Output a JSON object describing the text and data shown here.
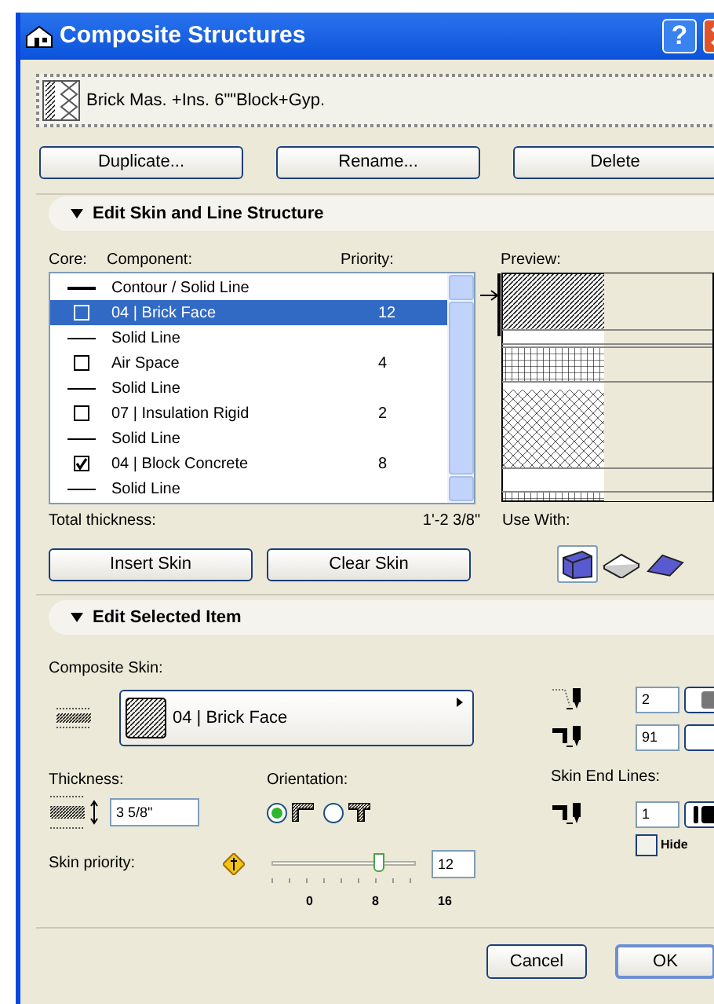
{
  "window": {
    "title": "Composite Structures",
    "help": "?"
  },
  "composite": {
    "name": "Brick Mas. +Ins. 6\"\"Block+Gyp."
  },
  "top_buttons": [
    "Duplicate...",
    "Rename...",
    "Delete"
  ],
  "skin_section": {
    "title": "Edit Skin and Line Structure",
    "expanded": true,
    "columns": [
      "Core:",
      "Component:",
      "Priority:"
    ],
    "rows": [
      {
        "kind": "line",
        "name": "Contour / Solid Line",
        "heavy": true
      },
      {
        "kind": "skin",
        "name": "04 | Brick Face",
        "core": false,
        "priority": "12",
        "selected": true
      },
      {
        "kind": "line",
        "name": "Solid Line",
        "heavy": false
      },
      {
        "kind": "skin",
        "name": "Air Space",
        "core": false,
        "priority": "4",
        "selected": false
      },
      {
        "kind": "line",
        "name": "Solid Line",
        "heavy": false
      },
      {
        "kind": "skin",
        "name": "07 | Insulation Rigid",
        "core": false,
        "priority": "2",
        "selected": false
      },
      {
        "kind": "line",
        "name": "Solid Line",
        "heavy": false
      },
      {
        "kind": "skin",
        "name": "04 | Block Concrete",
        "core": true,
        "priority": "8",
        "selected": false
      },
      {
        "kind": "line",
        "name": "Solid Line",
        "heavy": false
      }
    ],
    "preview_label": "Preview:",
    "total_label": "Total thickness:",
    "total_value": "1'-2 3/8\"",
    "buttons": [
      "Insert Skin",
      "Clear Skin"
    ],
    "use_with_label": "Use With:",
    "use_with": [
      {
        "kind": "wall",
        "selected": true
      },
      {
        "kind": "slab",
        "selected": false
      },
      {
        "kind": "roof",
        "selected": false
      }
    ]
  },
  "item_section": {
    "title": "Edit Selected Item",
    "expanded": true,
    "composite_skin_label": "Composite Skin:",
    "skin_name": "04 | Brick Face",
    "thickness_label": "Thickness:",
    "thickness": "3 5/8\"",
    "orientation_label": "Orientation:",
    "orientation": [
      {
        "selected": true
      },
      {
        "selected": false
      }
    ],
    "pens": [
      {
        "value": "2"
      },
      {
        "value": "91"
      }
    ],
    "end_lines_label": "Skin End Lines:",
    "end_pen": "1",
    "hide": {
      "label": "Hide",
      "checked": false
    },
    "priority": {
      "label": "Skin priority:",
      "value": "12",
      "level": 0.75,
      "ticks": [
        "0",
        "8",
        "16"
      ]
    }
  },
  "footer_buttons": [
    {
      "label": "Cancel",
      "default": false
    },
    {
      "label": "OK",
      "default": true
    }
  ]
}
